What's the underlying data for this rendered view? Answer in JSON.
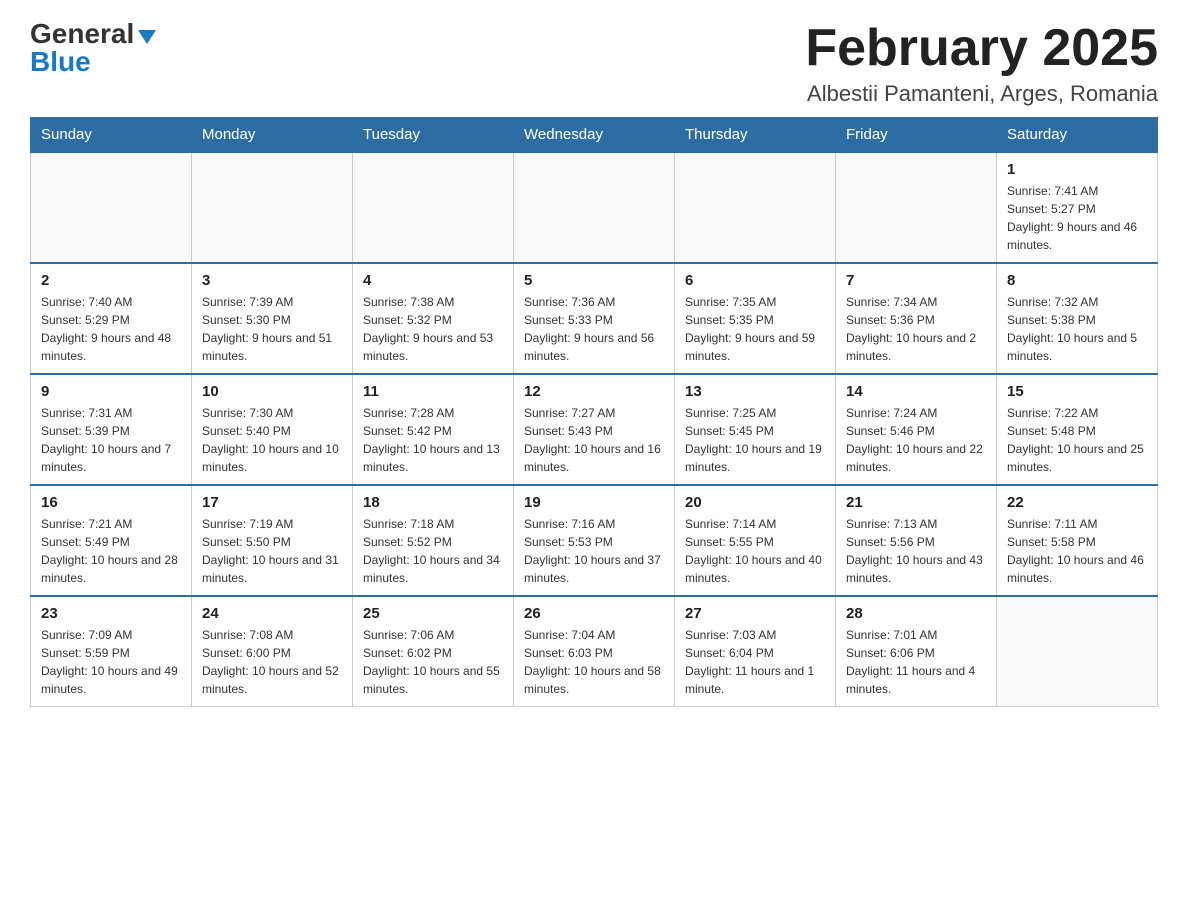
{
  "logo": {
    "general": "General",
    "blue": "Blue",
    "triangle": "▲"
  },
  "header": {
    "month_title": "February 2025",
    "location": "Albestii Pamanteni, Arges, Romania"
  },
  "calendar": {
    "days_of_week": [
      "Sunday",
      "Monday",
      "Tuesday",
      "Wednesday",
      "Thursday",
      "Friday",
      "Saturday"
    ],
    "weeks": [
      [
        {
          "day": "",
          "info": ""
        },
        {
          "day": "",
          "info": ""
        },
        {
          "day": "",
          "info": ""
        },
        {
          "day": "",
          "info": ""
        },
        {
          "day": "",
          "info": ""
        },
        {
          "day": "",
          "info": ""
        },
        {
          "day": "1",
          "info": "Sunrise: 7:41 AM\nSunset: 5:27 PM\nDaylight: 9 hours and 46 minutes."
        }
      ],
      [
        {
          "day": "2",
          "info": "Sunrise: 7:40 AM\nSunset: 5:29 PM\nDaylight: 9 hours and 48 minutes."
        },
        {
          "day": "3",
          "info": "Sunrise: 7:39 AM\nSunset: 5:30 PM\nDaylight: 9 hours and 51 minutes."
        },
        {
          "day": "4",
          "info": "Sunrise: 7:38 AM\nSunset: 5:32 PM\nDaylight: 9 hours and 53 minutes."
        },
        {
          "day": "5",
          "info": "Sunrise: 7:36 AM\nSunset: 5:33 PM\nDaylight: 9 hours and 56 minutes."
        },
        {
          "day": "6",
          "info": "Sunrise: 7:35 AM\nSunset: 5:35 PM\nDaylight: 9 hours and 59 minutes."
        },
        {
          "day": "7",
          "info": "Sunrise: 7:34 AM\nSunset: 5:36 PM\nDaylight: 10 hours and 2 minutes."
        },
        {
          "day": "8",
          "info": "Sunrise: 7:32 AM\nSunset: 5:38 PM\nDaylight: 10 hours and 5 minutes."
        }
      ],
      [
        {
          "day": "9",
          "info": "Sunrise: 7:31 AM\nSunset: 5:39 PM\nDaylight: 10 hours and 7 minutes."
        },
        {
          "day": "10",
          "info": "Sunrise: 7:30 AM\nSunset: 5:40 PM\nDaylight: 10 hours and 10 minutes."
        },
        {
          "day": "11",
          "info": "Sunrise: 7:28 AM\nSunset: 5:42 PM\nDaylight: 10 hours and 13 minutes."
        },
        {
          "day": "12",
          "info": "Sunrise: 7:27 AM\nSunset: 5:43 PM\nDaylight: 10 hours and 16 minutes."
        },
        {
          "day": "13",
          "info": "Sunrise: 7:25 AM\nSunset: 5:45 PM\nDaylight: 10 hours and 19 minutes."
        },
        {
          "day": "14",
          "info": "Sunrise: 7:24 AM\nSunset: 5:46 PM\nDaylight: 10 hours and 22 minutes."
        },
        {
          "day": "15",
          "info": "Sunrise: 7:22 AM\nSunset: 5:48 PM\nDaylight: 10 hours and 25 minutes."
        }
      ],
      [
        {
          "day": "16",
          "info": "Sunrise: 7:21 AM\nSunset: 5:49 PM\nDaylight: 10 hours and 28 minutes."
        },
        {
          "day": "17",
          "info": "Sunrise: 7:19 AM\nSunset: 5:50 PM\nDaylight: 10 hours and 31 minutes."
        },
        {
          "day": "18",
          "info": "Sunrise: 7:18 AM\nSunset: 5:52 PM\nDaylight: 10 hours and 34 minutes."
        },
        {
          "day": "19",
          "info": "Sunrise: 7:16 AM\nSunset: 5:53 PM\nDaylight: 10 hours and 37 minutes."
        },
        {
          "day": "20",
          "info": "Sunrise: 7:14 AM\nSunset: 5:55 PM\nDaylight: 10 hours and 40 minutes."
        },
        {
          "day": "21",
          "info": "Sunrise: 7:13 AM\nSunset: 5:56 PM\nDaylight: 10 hours and 43 minutes."
        },
        {
          "day": "22",
          "info": "Sunrise: 7:11 AM\nSunset: 5:58 PM\nDaylight: 10 hours and 46 minutes."
        }
      ],
      [
        {
          "day": "23",
          "info": "Sunrise: 7:09 AM\nSunset: 5:59 PM\nDaylight: 10 hours and 49 minutes."
        },
        {
          "day": "24",
          "info": "Sunrise: 7:08 AM\nSunset: 6:00 PM\nDaylight: 10 hours and 52 minutes."
        },
        {
          "day": "25",
          "info": "Sunrise: 7:06 AM\nSunset: 6:02 PM\nDaylight: 10 hours and 55 minutes."
        },
        {
          "day": "26",
          "info": "Sunrise: 7:04 AM\nSunset: 6:03 PM\nDaylight: 10 hours and 58 minutes."
        },
        {
          "day": "27",
          "info": "Sunrise: 7:03 AM\nSunset: 6:04 PM\nDaylight: 11 hours and 1 minute."
        },
        {
          "day": "28",
          "info": "Sunrise: 7:01 AM\nSunset: 6:06 PM\nDaylight: 11 hours and 4 minutes."
        },
        {
          "day": "",
          "info": ""
        }
      ]
    ]
  }
}
